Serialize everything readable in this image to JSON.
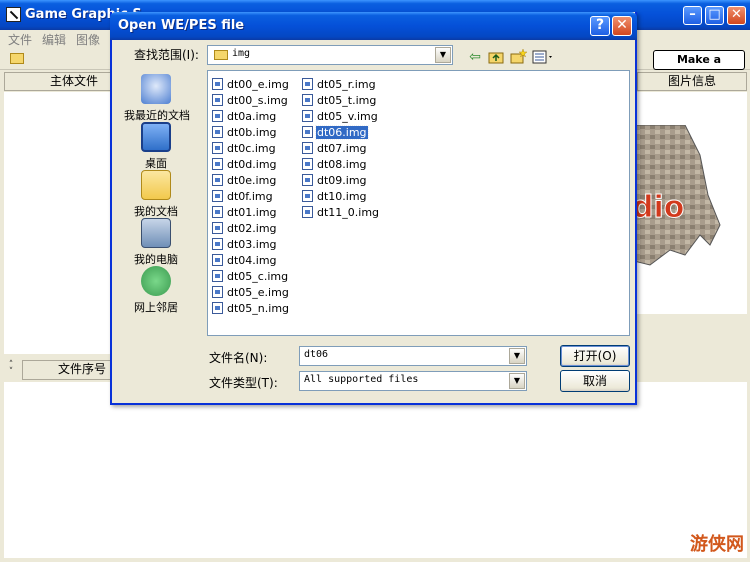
{
  "main_window": {
    "title": "Game Graphic S",
    "menus": [
      "文件",
      "编辑",
      "图像"
    ],
    "donate_label": "Make a donation",
    "header_left": "主体文件",
    "header_right": "图片信息",
    "list_header": "文件序号",
    "preview_text": "dio",
    "watermark": "游侠网"
  },
  "dialog": {
    "title": "Open WE/PES file",
    "help_label": "?",
    "close_label": "✕",
    "look_in_label": "查找范围(I):",
    "look_in_value": "img",
    "places": [
      {
        "label": "我最近的文档",
        "icon": "recent-documents-icon",
        "color": "#4e7fd1"
      },
      {
        "label": "桌面",
        "icon": "desktop-icon",
        "color": "#2f6fc9"
      },
      {
        "label": "我的文档",
        "icon": "my-documents-icon",
        "color": "#f2c94c"
      },
      {
        "label": "我的电脑",
        "icon": "my-computer-icon",
        "color": "#6f8fb7"
      },
      {
        "label": "网上邻居",
        "icon": "network-places-icon",
        "color": "#3a9a4f"
      }
    ],
    "files": [
      {
        "name": "dt00_e.img",
        "selected": false
      },
      {
        "name": "dt00_s.img",
        "selected": false
      },
      {
        "name": "dt0a.img",
        "selected": false
      },
      {
        "name": "dt0b.img",
        "selected": false
      },
      {
        "name": "dt0c.img",
        "selected": false
      },
      {
        "name": "dt0d.img",
        "selected": false
      },
      {
        "name": "dt0e.img",
        "selected": false
      },
      {
        "name": "dt0f.img",
        "selected": false
      },
      {
        "name": "dt01.img",
        "selected": false
      },
      {
        "name": "dt02.img",
        "selected": false
      },
      {
        "name": "dt03.img",
        "selected": false
      },
      {
        "name": "dt04.img",
        "selected": false
      },
      {
        "name": "dt05_c.img",
        "selected": false
      },
      {
        "name": "dt05_e.img",
        "selected": false
      },
      {
        "name": "dt05_n.img",
        "selected": false
      },
      {
        "name": "dt05_r.img",
        "selected": false
      },
      {
        "name": "dt05_t.img",
        "selected": false
      },
      {
        "name": "dt05_v.img",
        "selected": false
      },
      {
        "name": "dt06.img",
        "selected": true
      },
      {
        "name": "dt07.img",
        "selected": false
      },
      {
        "name": "dt08.img",
        "selected": false
      },
      {
        "name": "dt09.img",
        "selected": false
      },
      {
        "name": "dt10.img",
        "selected": false
      },
      {
        "name": "dt11_0.img",
        "selected": false
      }
    ],
    "filename_label": "文件名(N):",
    "filename_value": "dt06",
    "filetype_label": "文件类型(T):",
    "filetype_value": "All supported files",
    "open_label": "打开(O)",
    "cancel_label": "取消"
  }
}
